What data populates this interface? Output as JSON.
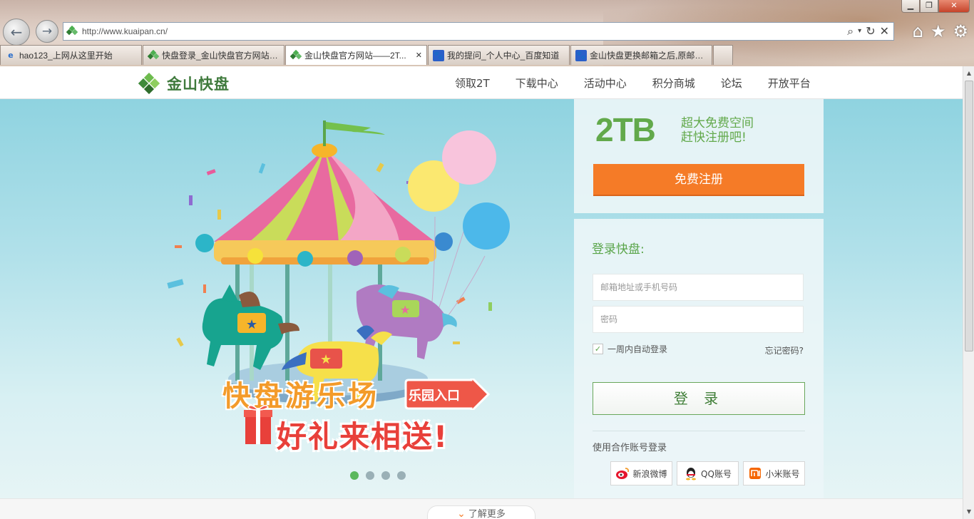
{
  "browser": {
    "url": "http://www.kuaipan.cn/",
    "tabs": [
      {
        "title": "hao123_上网从这里开始",
        "icon": "ie-icon"
      },
      {
        "title": "快盘登录_金山快盘官方网站_...",
        "icon": "kuaipan-favicon"
      },
      {
        "title": "金山快盘官方网站——2T...",
        "icon": "kuaipan-favicon",
        "active": true
      },
      {
        "title": "我的提问_个人中心_百度知道",
        "icon": "baidu-paw-icon"
      },
      {
        "title": "金山快盘更换邮箱之后,原邮箱...",
        "icon": "baidu-paw-icon"
      }
    ]
  },
  "site": {
    "logo_text": "金山快盘",
    "nav": [
      "领取2T",
      "下载中心",
      "活动中心",
      "积分商城",
      "论坛",
      "开放平台"
    ]
  },
  "promo": {
    "title_line1": "快盘游乐场",
    "title_line2": "好礼来相送!",
    "entry_button": "乐园入口",
    "slide_count": 4,
    "active_slide": 1
  },
  "register": {
    "big": "2TB",
    "tag_line1": "超大免费空间",
    "tag_line2": "赶快注册吧!",
    "button": "免费注册"
  },
  "login": {
    "title": "登录快盘:",
    "email_placeholder": "邮箱地址或手机号码",
    "password_placeholder": "密码",
    "remember_label": "一周内自动登录",
    "remember_checked": true,
    "forgot": "忘记密码?",
    "button": "登 录",
    "partner_title": "使用合作账号登录",
    "partners": [
      "新浪微博",
      "QQ账号",
      "小米账号"
    ]
  },
  "learn_more": "了解更多",
  "colors": {
    "brand_green": "#5aa54a",
    "orange": "#f57b27",
    "hero_blue": "#8fd3e0"
  }
}
